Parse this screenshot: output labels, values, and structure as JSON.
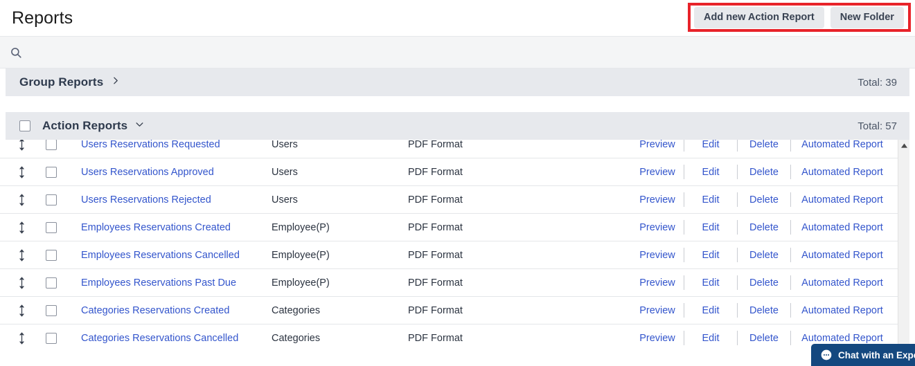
{
  "header": {
    "title": "Reports",
    "add_report_label": "Add new Action Report",
    "new_folder_label": "New Folder",
    "highlight_color": "#e8232a"
  },
  "search": {
    "icon": "search-icon",
    "value": "",
    "placeholder": ""
  },
  "sections": [
    {
      "title": "Group Reports",
      "chevron": "chevron-right-icon",
      "total_label": "Total: 39",
      "has_checkbox": false,
      "expanded": false
    },
    {
      "title": "Action Reports",
      "chevron": "chevron-down-icon",
      "total_label": "Total: 57",
      "has_checkbox": true,
      "expanded": true
    }
  ],
  "table": {
    "actions": {
      "preview": "Preview",
      "edit": "Edit",
      "delete": "Delete",
      "automated": "Automated Report"
    },
    "rows": [
      {
        "name": "Users Reservations Requested",
        "type": "Users",
        "format": "PDF Format"
      },
      {
        "name": "Users Reservations Approved",
        "type": "Users",
        "format": "PDF Format"
      },
      {
        "name": "Users Reservations Rejected",
        "type": "Users",
        "format": "PDF Format"
      },
      {
        "name": "Employees Reservations Created",
        "type": "Employee(P)",
        "format": "PDF Format"
      },
      {
        "name": "Employees Reservations Cancelled",
        "type": "Employee(P)",
        "format": "PDF Format"
      },
      {
        "name": "Employees Reservations Past Due",
        "type": "Employee(P)",
        "format": "PDF Format"
      },
      {
        "name": "Categories Reservations Created",
        "type": "Categories",
        "format": "PDF Format"
      },
      {
        "name": "Categories Reservations Cancelled",
        "type": "Categories",
        "format": "PDF Format"
      }
    ]
  },
  "chat": {
    "label": "Chat with an Expert",
    "icon": "chat-bubble-icon",
    "color": "#14487f"
  },
  "colors": {
    "link": "#3355cc",
    "section_bar": "#e7e9ed",
    "button_bg": "#e7e9ec",
    "search_bg": "#f4f5f6"
  }
}
